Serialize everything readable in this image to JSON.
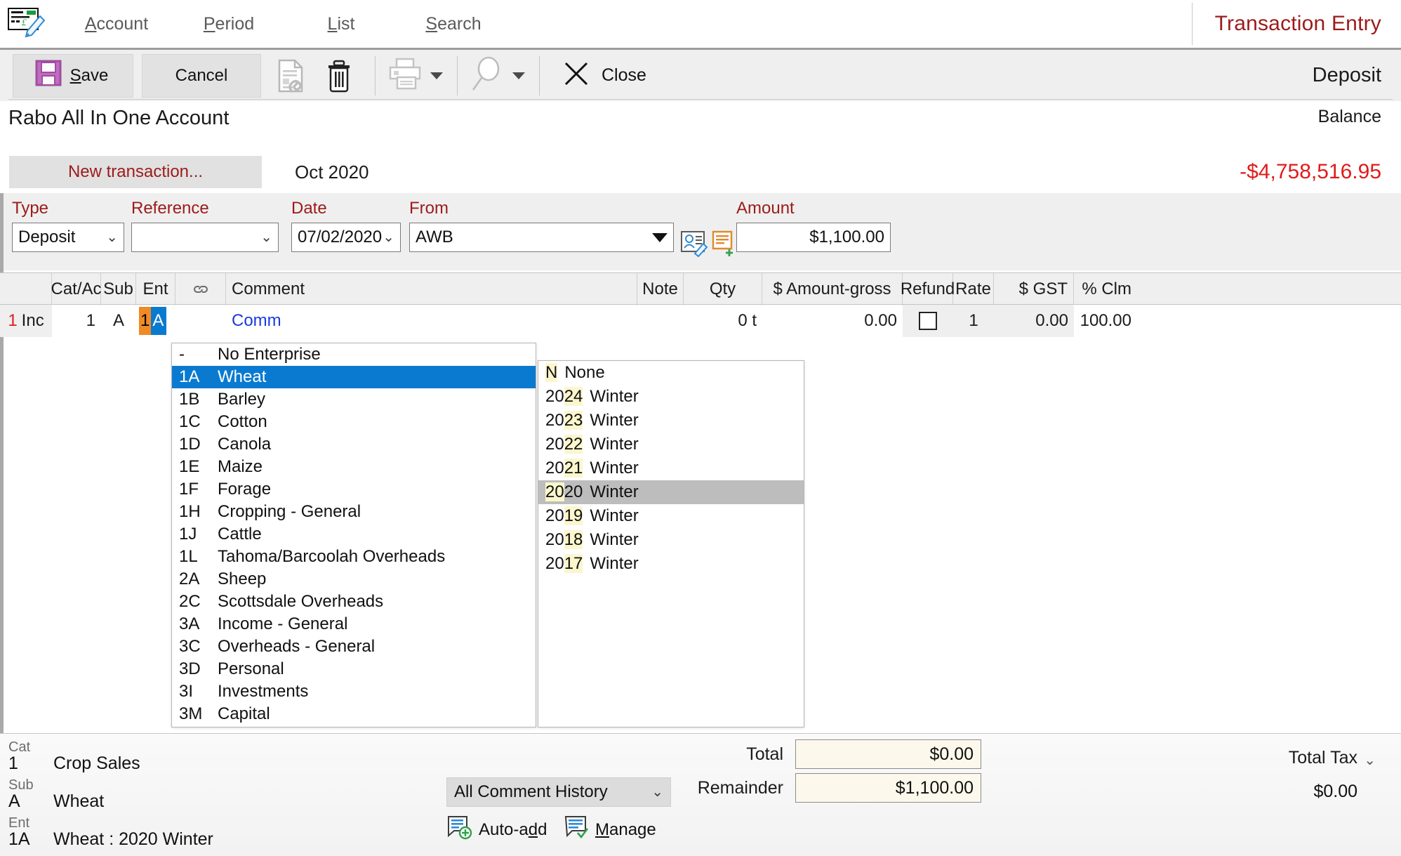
{
  "menu": {
    "items": [
      {
        "label": "Account",
        "accel": "A"
      },
      {
        "label": "Period",
        "accel": "P"
      },
      {
        "label": "List",
        "accel": "L"
      },
      {
        "label": "Search",
        "accel": "S"
      }
    ],
    "app_title": "Transaction Entry",
    "app_icon": "cheque-pencil-icon"
  },
  "toolbar": {
    "save_label": "Save",
    "cancel_label": "Cancel",
    "attach_icon": "document-attachment-icon",
    "delete_icon": "trash-icon",
    "print_icon": "printer-icon",
    "search_icon": "magnifier-icon",
    "close_icon": "close-x-icon",
    "close_label": "Close",
    "mode_label": "Deposit"
  },
  "account": {
    "name": "Rabo All In One Account",
    "balance_label": "Balance",
    "balance_value": "-$4,758,516.95",
    "balance_color": "#e01b1b",
    "tab_new": "New transaction...",
    "tab_period": "Oct 2020"
  },
  "fields": {
    "type": {
      "label": "Type",
      "value": "Deposit"
    },
    "reference": {
      "label": "Reference",
      "value": ""
    },
    "date": {
      "label": "Date",
      "value": "07/02/2020"
    },
    "from": {
      "label": "From",
      "value": "AWB"
    },
    "amount": {
      "label": "Amount",
      "value": "$1,100.00"
    },
    "contact_icon": "contact-edit-icon",
    "note_add_icon": "note-add-icon"
  },
  "grid": {
    "headers": [
      "",
      "Cat/Ac",
      "Sub",
      "Ent",
      "link-icon",
      "Comment",
      "Note",
      "Qty",
      "$ Amount-gross",
      "Refund",
      "Rate",
      "$ GST",
      "% Clm"
    ],
    "row": {
      "index": "1",
      "index_type": "Inc",
      "cat_ac": "1",
      "sub": "A",
      "ent_code_1": "1",
      "ent_code_2": "A",
      "comment": "Comm",
      "note": "",
      "qty": "0 t",
      "amount_gross": "0.00",
      "refund": false,
      "rate": "1",
      "gst": "0.00",
      "clm": "100.00"
    }
  },
  "enterprise_dropdown": {
    "selected_code": "1A",
    "items": [
      {
        "code": "-",
        "label": "No Enterprise"
      },
      {
        "code": "1A",
        "label": "Wheat"
      },
      {
        "code": "1B",
        "label": "Barley"
      },
      {
        "code": "1C",
        "label": "Cotton"
      },
      {
        "code": "1D",
        "label": "Canola"
      },
      {
        "code": "1E",
        "label": "Maize"
      },
      {
        "code": "1F",
        "label": "Forage"
      },
      {
        "code": "1H",
        "label": "Cropping - General"
      },
      {
        "code": "1J",
        "label": "Cattle"
      },
      {
        "code": "1L",
        "label": "Tahoma/Barcoolah Overheads"
      },
      {
        "code": "2A",
        "label": "Sheep"
      },
      {
        "code": "2C",
        "label": "Scottsdale Overheads"
      },
      {
        "code": "3A",
        "label": "Income - General"
      },
      {
        "code": "3C",
        "label": "Overheads - General"
      },
      {
        "code": "3D",
        "label": "Personal"
      },
      {
        "code": "3I",
        "label": "Investments"
      },
      {
        "code": "3M",
        "label": "Capital"
      }
    ]
  },
  "season_dropdown": {
    "highlighted": "2020 Winter",
    "items": [
      {
        "code": "N",
        "label": "None",
        "hi": "N"
      },
      {
        "code": "2024",
        "label": "Winter",
        "hi": "24"
      },
      {
        "code": "2023",
        "label": "Winter",
        "hi": "23"
      },
      {
        "code": "2022",
        "label": "Winter",
        "hi": "22"
      },
      {
        "code": "2021",
        "label": "Winter",
        "hi": "21"
      },
      {
        "code": "2020",
        "label": "Winter",
        "hi": "20"
      },
      {
        "code": "2019",
        "label": "Winter",
        "hi": "19"
      },
      {
        "code": "2018",
        "label": "Winter",
        "hi": "18"
      },
      {
        "code": "2017",
        "label": "Winter",
        "hi": "17"
      }
    ]
  },
  "bottom": {
    "cat_label": "Cat",
    "cat_code": "1",
    "cat_name": "Crop Sales",
    "sub_label": "Sub",
    "sub_code": "A",
    "sub_name": "Wheat",
    "ent_label": "Ent",
    "ent_code": "1A",
    "ent_name": "Wheat : 2020 Winter",
    "comment_history": "All Comment History",
    "auto_add_label": "Auto-add",
    "auto_add_icon": "comment-add-icon",
    "manage_label": "Manage",
    "manage_icon": "comment-check-icon",
    "total_label": "Total",
    "total_value": "$0.00",
    "remainder_label": "Remainder",
    "remainder_value": "$1,100.00",
    "total_tax_label": "Total Tax",
    "total_tax_value": "$0.00"
  }
}
